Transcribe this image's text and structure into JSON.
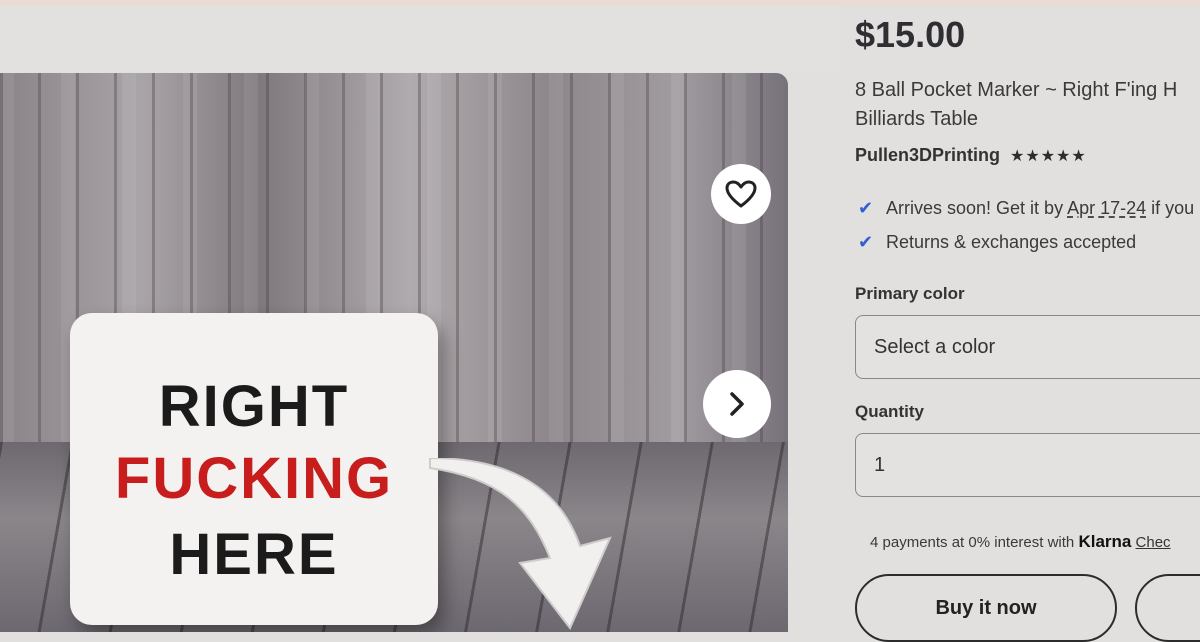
{
  "listing": {
    "price": "$15.00",
    "title_line1": "8 Ball Pocket Marker ~ Right F'ing H",
    "title_line2": "Billiards Table",
    "shop_name": "Pullen3DPrinting",
    "stars": "★★★★★",
    "rating": 5
  },
  "image": {
    "sign_line1": "RIGHT",
    "sign_line2": "FUCKING",
    "sign_line3": "HERE",
    "favorite_icon": "heart-outline-icon",
    "next_icon": "chevron-right-icon"
  },
  "shipping": {
    "arrives_prefix": "Arrives soon! Get it by ",
    "arrives_dates": "Apr 17-24",
    "arrives_suffix": " if you",
    "returns": "Returns & exchanges accepted",
    "check_icon": "checkmark-icon"
  },
  "options": {
    "color_label": "Primary color",
    "color_placeholder": "Select a color",
    "quantity_label": "Quantity",
    "quantity_value": "1"
  },
  "payments": {
    "text": "4 payments at 0% interest with ",
    "brand": "Klarna",
    "link": "Chec"
  },
  "actions": {
    "buy_label": "Buy it now",
    "add_to_cart_label": ""
  },
  "colors": {
    "accent_check": "#2f5fd1",
    "sign_red": "#c71d1d",
    "background": "#e2e0df"
  }
}
